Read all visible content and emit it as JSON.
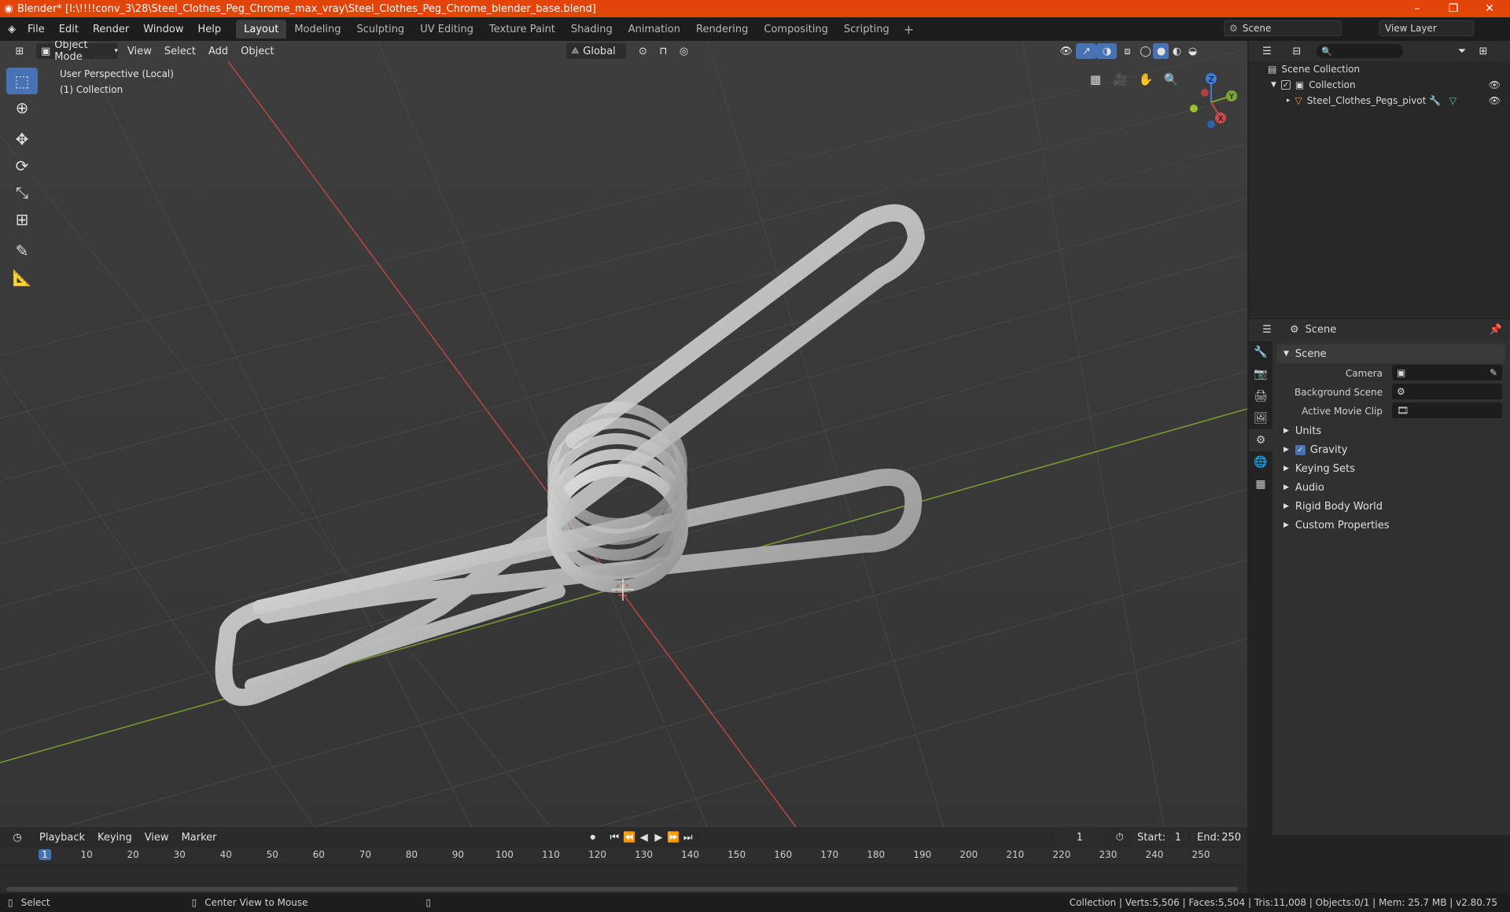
{
  "window": {
    "title": "Blender* [I:\\!!!!conv_3\\28\\Steel_Clothes_Peg_Chrome_max_vray\\Steel_Clothes_Peg_Chrome_blender_base.blend]",
    "minimize": "–",
    "maximize": "❐",
    "close": "✕"
  },
  "menu": [
    "File",
    "Edit",
    "Render",
    "Window",
    "Help"
  ],
  "workspaces": [
    "Layout",
    "Modeling",
    "Sculpting",
    "UV Editing",
    "Texture Paint",
    "Shading",
    "Animation",
    "Rendering",
    "Compositing",
    "Scripting"
  ],
  "workspace_add": "+",
  "scene_selector": {
    "value": "Scene"
  },
  "view_layer": {
    "value": "View Layer"
  },
  "viewport": {
    "mode": "Object Mode",
    "menus": [
      "View",
      "Select",
      "Add",
      "Object"
    ],
    "transform_orientation": "Global",
    "info_line1": "User Perspective (Local)",
    "info_line2": "(1) Collection",
    "gizmo": {
      "x": "X",
      "y": "Y",
      "z": "Z"
    }
  },
  "outliner": {
    "root": "Scene Collection",
    "collection": "Collection",
    "object": "Steel_Clothes_Pegs_pivot",
    "search_placeholder": ""
  },
  "properties": {
    "header": "Scene",
    "section": "Scene",
    "camera_label": "Camera",
    "background_label": "Background Scene",
    "movieclip_label": "Active Movie Clip",
    "panels": [
      "Units",
      "Gravity",
      "Keying Sets",
      "Audio",
      "Rigid Body World",
      "Custom Properties"
    ]
  },
  "timeline": {
    "menus": [
      "Playback",
      "Keying",
      "View",
      "Marker"
    ],
    "current_frame": "1",
    "start_label": "Start:",
    "start": "1",
    "end_label": "End:",
    "end": "250",
    "ticks": [
      "1",
      "10",
      "20",
      "30",
      "40",
      "50",
      "60",
      "70",
      "80",
      "90",
      "100",
      "110",
      "120",
      "130",
      "140",
      "150",
      "160",
      "170",
      "180",
      "190",
      "200",
      "210",
      "220",
      "230",
      "240",
      "250"
    ]
  },
  "status": {
    "select": "Select",
    "center_view": "Center View to Mouse",
    "stats": "Collection | Verts:5,506 | Faces:5,504 | Tris:11,008 | Objects:0/1 | Mem: 25.7 MB | v2.80.75"
  },
  "colors": {
    "titlebar": "#e3440a",
    "accent": "#4772b3",
    "x_axis": "#c94a4a",
    "y_axis": "#7fa52e",
    "z_axis": "#3b7dd8"
  }
}
